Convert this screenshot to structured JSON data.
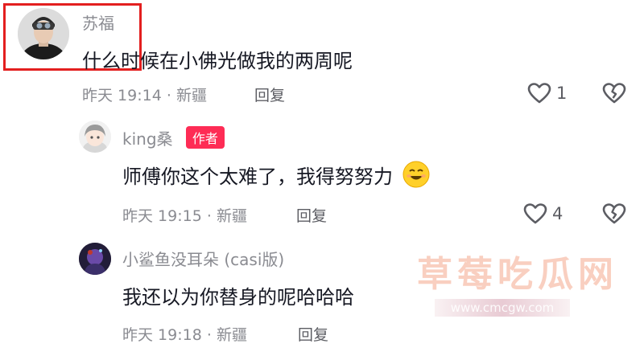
{
  "comments": [
    {
      "username": "苏福",
      "content": "什么时候在小佛光做我的两周呢",
      "time": "昨天 19:14",
      "location": "新疆",
      "reply_label": "回复",
      "like_count": "1"
    },
    {
      "username": "king桑",
      "badge": "作者",
      "content": "师傅你这个太难了，我得努努力",
      "time": "昨天 19:15",
      "location": "新疆",
      "reply_label": "回复",
      "like_count": "4"
    },
    {
      "username": "小鲨鱼没耳朵 (casi版)",
      "content": "我还以为你替身的呢哈哈哈",
      "time": "昨天 19:18",
      "location": "新疆",
      "reply_label": "回复"
    }
  ],
  "watermark": {
    "text": "草莓吃瓜网",
    "url": "www.cmcgw.com"
  },
  "colors": {
    "accent": "#fe2c55",
    "highlight": "#e31f1f",
    "text_primary": "#161823",
    "text_secondary": "#8a8b91"
  },
  "icons": [
    "heart-outline-icon",
    "broken-heart-icon",
    "smile-emoji-icon"
  ]
}
